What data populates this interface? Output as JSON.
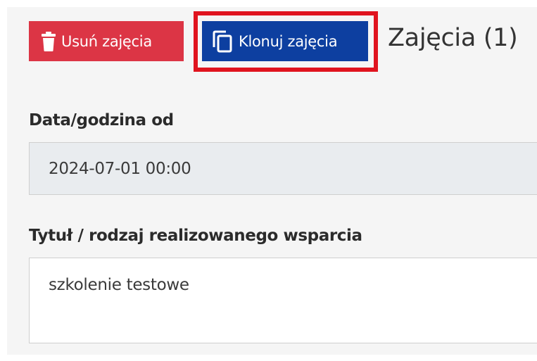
{
  "toolbar": {
    "delete_label": "Usuń zajęcia",
    "delete_icon": "trash-icon",
    "clone_label": "Klonuj zajęcia",
    "clone_icon": "copy-icon"
  },
  "section": {
    "title": "Zajęcia (1)"
  },
  "form": {
    "date_label": "Data/godzina od",
    "date_value": "2024-07-01 00:00",
    "title_label": "Tytuł / rodzaj realizowanego wsparcia",
    "title_value": "szkolenie testowe"
  },
  "colors": {
    "delete_button": "#dc3545",
    "clone_button": "#0d3fa0",
    "highlight_border": "#e0141f",
    "readonly_field": "#e9ecef"
  }
}
